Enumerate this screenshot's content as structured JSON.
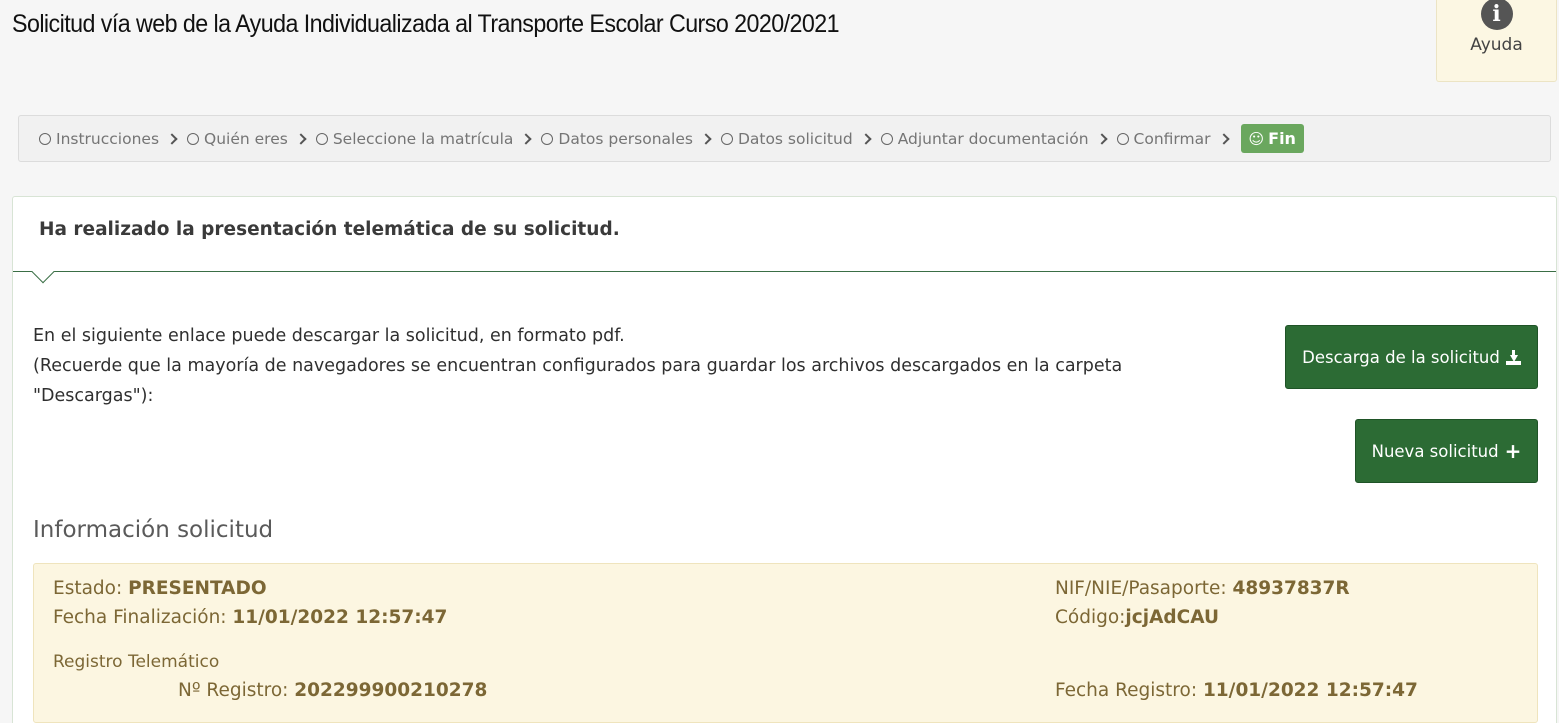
{
  "header": {
    "title": "Solicitud vía web de la Ayuda Individualizada al Transporte Escolar Curso 2020/2021",
    "help_label": "Ayuda",
    "help_icon": "info-icon"
  },
  "steps": [
    "Instrucciones",
    "Quién eres",
    "Seleccione la matrícula",
    "Datos personales",
    "Datos solicitud",
    "Adjuntar documentación",
    "Confirmar"
  ],
  "final_step": {
    "label": "Fin",
    "icon": "smile-icon",
    "color": "#6aa75e"
  },
  "panel": {
    "heading": "Ha realizado la presentación telemática de su solicitud.",
    "intro_line1": "En el siguiente enlace puede descargar la solicitud, en formato pdf.",
    "intro_line2": "(Recuerde que la mayoría de navegadores se encuentran configurados para guardar los archivos descargados en la carpeta \"Descargas\"):",
    "download_button": "Descarga de la solicitud",
    "new_button": "Nueva solicitud",
    "accent_color": "#2c6b34"
  },
  "info": {
    "section_title": "Información solicitud",
    "estado_label": "Estado: ",
    "estado_value": "PRESENTADO",
    "fecha_fin_label": "Fecha Finalización: ",
    "fecha_fin_value": "11/01/2022 12:57:47",
    "nif_label": "NIF/NIE/Pasaporte: ",
    "nif_value": "48937837R",
    "codigo_label": "Código:",
    "codigo_value": "jcjAdCAU",
    "registro_title": "Registro Telemático",
    "nreg_label": "Nº Registro: ",
    "nreg_value": "202299900210278",
    "fecha_reg_label": "Fecha Registro: ",
    "fecha_reg_value": "11/01/2022 12:57:47"
  }
}
